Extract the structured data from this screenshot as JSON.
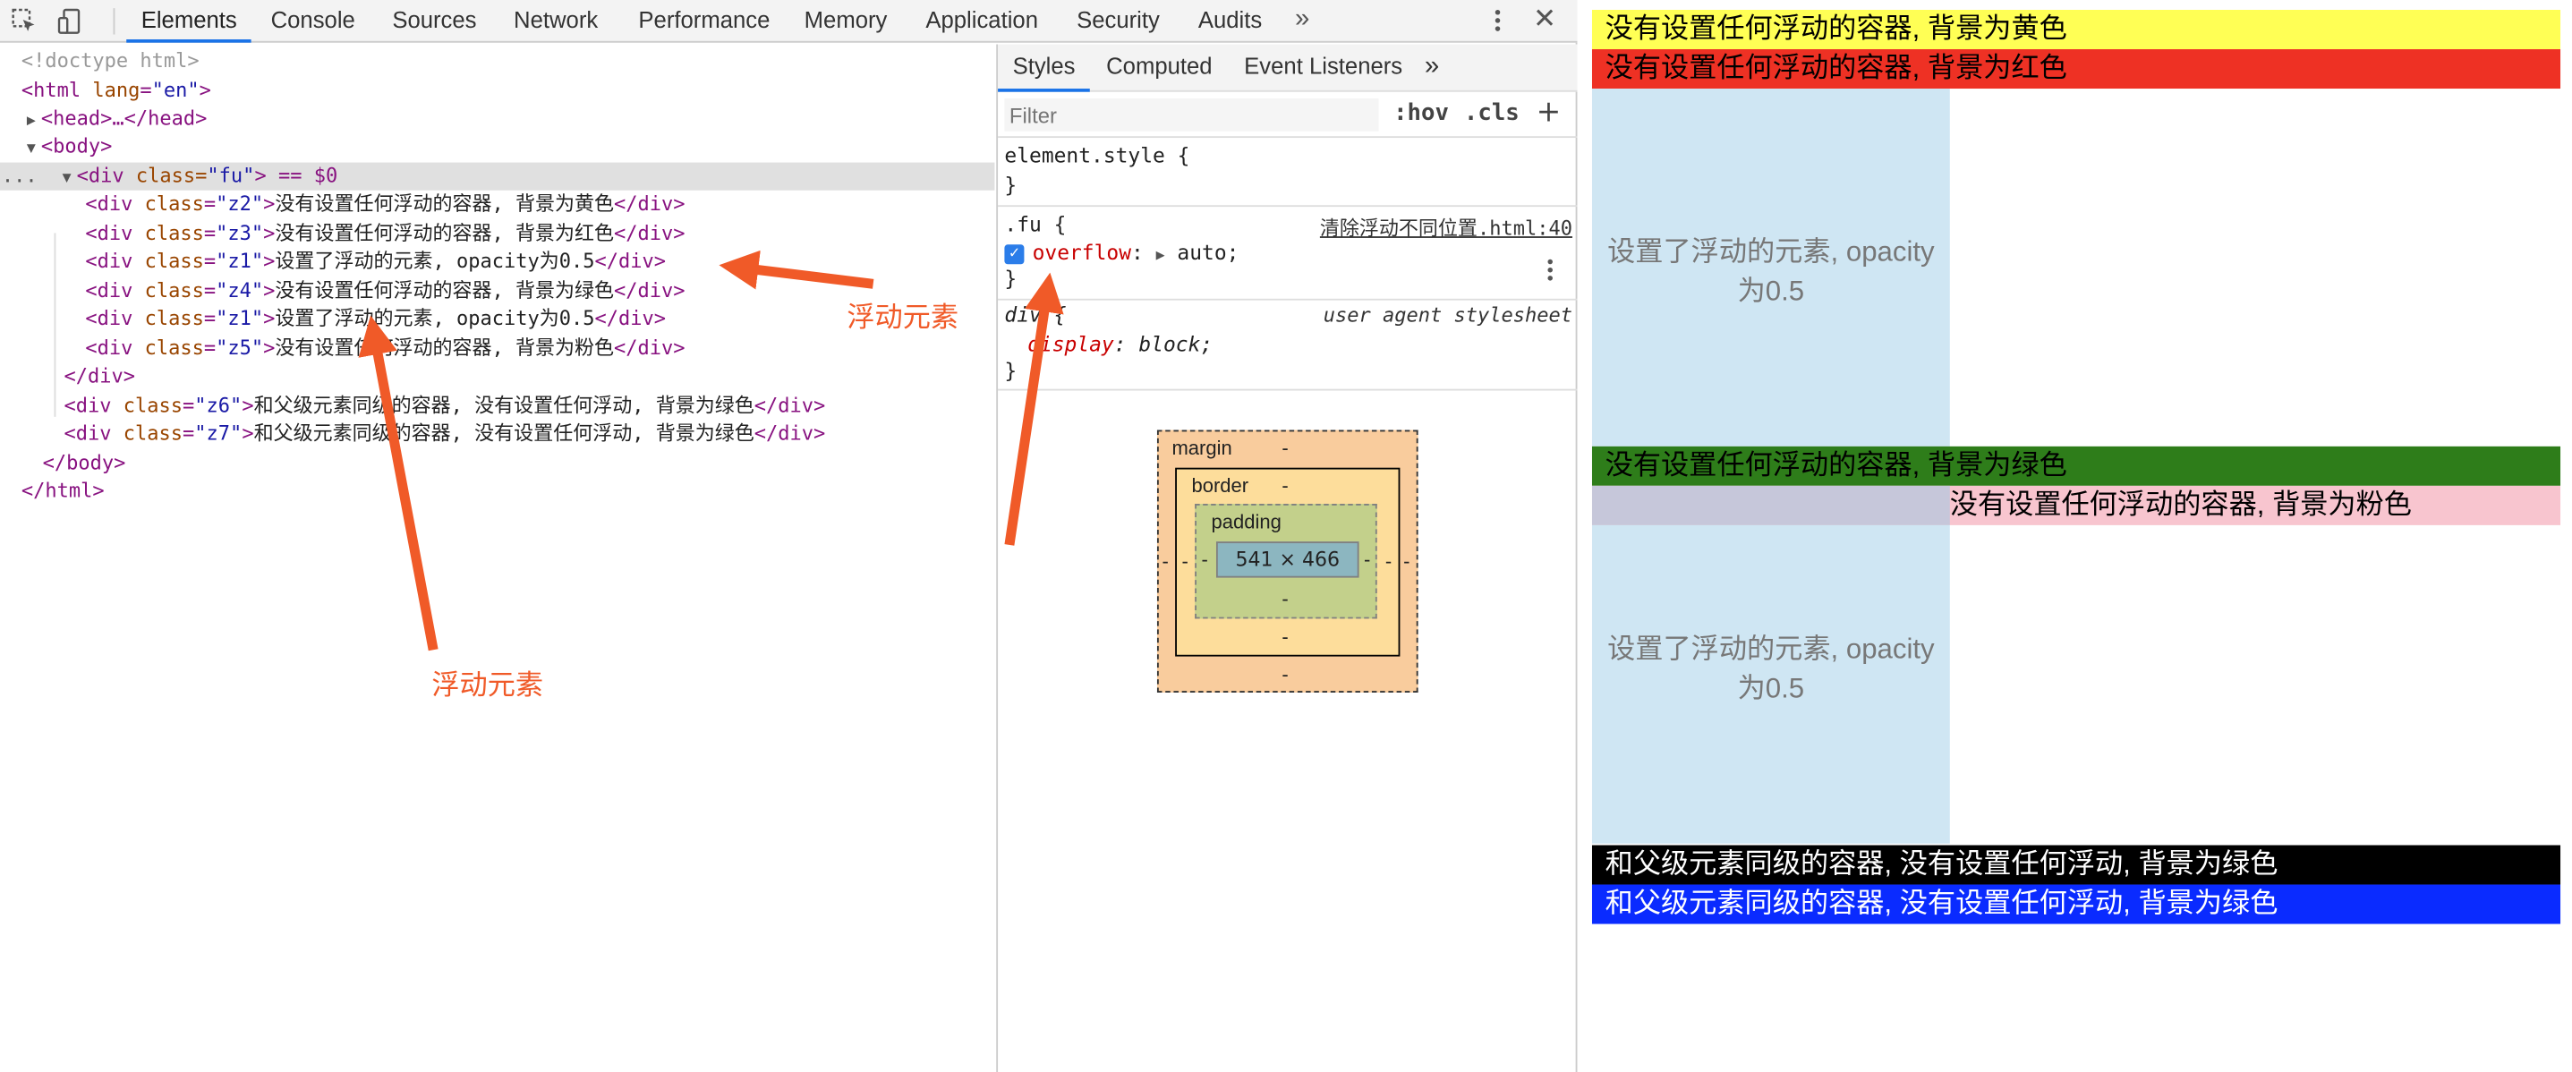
{
  "toolbar": {
    "tabs": [
      "Elements",
      "Console",
      "Sources",
      "Network",
      "Performance",
      "Memory",
      "Application",
      "Security",
      "Audits"
    ],
    "more": "»",
    "close": "✕"
  },
  "dom": {
    "doctype": "<!doctype html>",
    "html_open": "<html",
    "lang_attr": "lang",
    "lang_val": "\"en\"",
    "head": "<head>…</head>",
    "body_open": "<body>",
    "fu_tag": "<div",
    "fu_attr": "class=",
    "fu_val": "\"fu\"",
    "fu_suffix": "> == $0",
    "ellipsis": "...",
    "children": [
      {
        "cls": "\"z2\"",
        "text": "没有设置任何浮动的容器, 背景为黄色"
      },
      {
        "cls": "\"z3\"",
        "text": "没有设置任何浮动的容器, 背景为红色"
      },
      {
        "cls": "\"z1\"",
        "text": "设置了浮动的元素, opacity为0.5"
      },
      {
        "cls": "\"z4\"",
        "text": "没有设置任何浮动的容器, 背景为绿色"
      },
      {
        "cls": "\"z1\"",
        "text": "设置了浮动的元素, opacity为0.5"
      },
      {
        "cls": "\"z5\"",
        "text": "没有设置任何浮动的容器, 背景为粉色"
      }
    ],
    "div_close": "</div>",
    "siblings": [
      {
        "cls": "\"z6\"",
        "text": "和父级元素同级的容器, 没有设置任何浮动, 背景为绿色"
      },
      {
        "cls": "\"z7\"",
        "text": "和父级元素同级的容器, 没有设置任何浮动, 背景为绿色"
      }
    ],
    "body_close": "</body>",
    "html_close": "</html>"
  },
  "styles_panel": {
    "tabs": [
      "Styles",
      "Computed",
      "Event Listeners"
    ],
    "more": "»",
    "filter_placeholder": "Filter",
    "hov": ":hov",
    "cls": ".cls",
    "plus": "+",
    "element_style": "element.style {",
    "close_brace": "}",
    "fu_selector": ".fu {",
    "fu_source": "清除浮动不同位置.html:40",
    "overflow_prop": "overflow",
    "overflow_val": "auto;",
    "div_selector": "div {",
    "ua_label": "user agent stylesheet",
    "display_prop": "display",
    "display_val": "block;"
  },
  "box_model": {
    "margin_label": "margin",
    "border_label": "border",
    "padding_label": "padding",
    "dash": "-",
    "content_size": "541 × 466"
  },
  "preview": {
    "yellow": "没有设置任何浮动的容器, 背景为黄色",
    "red": "没有设置任何浮动的容器, 背景为红色",
    "float1": "设置了浮动的元素, opacity为0.5",
    "green": "没有设置任何浮动的容器, 背景为绿色",
    "pink": "没有设置任何浮动的容器, 背景为粉色",
    "float2": "设置了浮动的元素, opacity为0.5",
    "black": "和父级元素同级的容器, 没有设置任何浮动, 背景为绿色",
    "blue": "和父级元素同级的容器, 没有设置任何浮动, 背景为绿色"
  },
  "annotations": {
    "label1": "浮动元素",
    "label2": "浮动元素",
    "color": "#f05a28"
  }
}
